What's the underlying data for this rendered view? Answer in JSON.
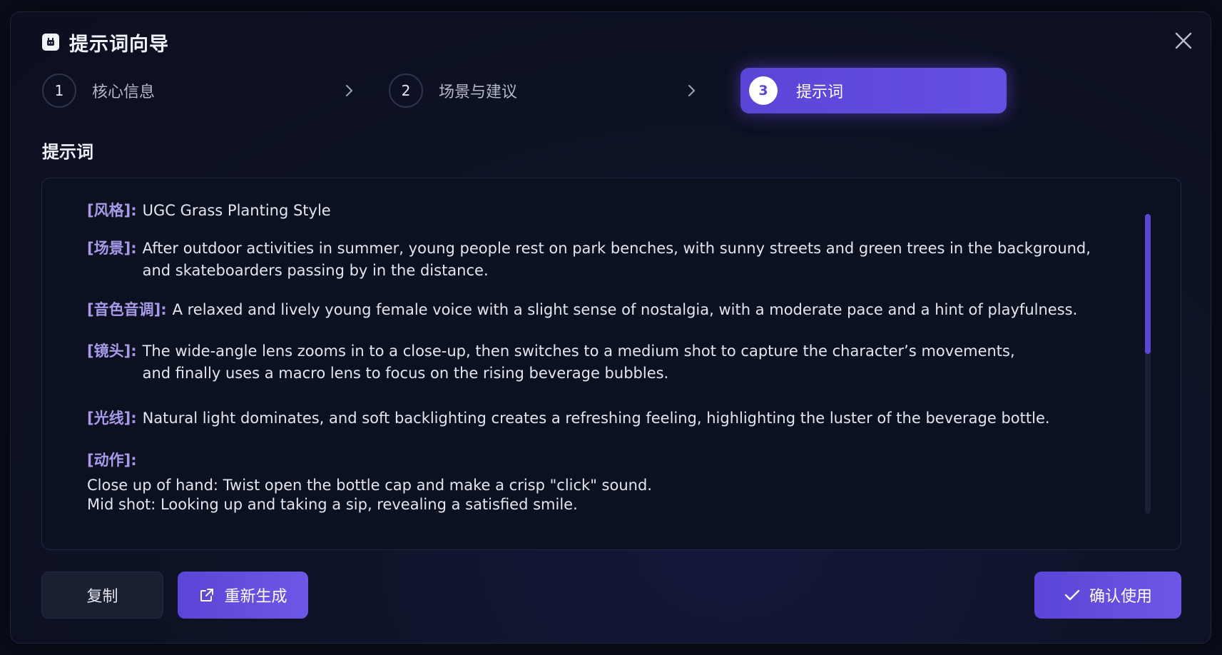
{
  "dialog": {
    "title": "提示词向导"
  },
  "steps": [
    {
      "number": "1",
      "label": "核心信息"
    },
    {
      "number": "2",
      "label": "场景与建议"
    },
    {
      "number": "3",
      "label": "提示词"
    }
  ],
  "section": {
    "title": "提示词"
  },
  "prompt": {
    "style_tag": "[风格]:",
    "style_text": "UGC Grass Planting Style",
    "scene_tag": "[场景]:",
    "scene_line1": "After outdoor activities in summer, young people rest on park benches, with sunny streets and green trees in the background,",
    "scene_line2": "and skateboarders passing by in the distance.",
    "voice_tag": "[音色音调]:",
    "voice_text": "A relaxed and lively young female voice with a slight sense of nostalgia, with a moderate pace and a hint of playfulness.",
    "lens_tag": "[镜头]:",
    "lens_line1": "The wide-angle lens zooms in to a close-up, then switches to a medium shot to capture the character’s movements,",
    "lens_line2": "and finally uses a macro lens to focus on the rising beverage bubbles.",
    "light_tag": "[光线]:",
    "light_text": "Natural light dominates, and soft backlighting creates a refreshing feeling, highlighting the luster of the beverage bottle.",
    "action_tag": "[动作]:",
    "action_line1": "Close up of hand: Twist open the bottle cap and make a crisp \"click\" sound.",
    "action_line2": "Mid shot: Looking up and taking a sip, revealing a satisfied smile."
  },
  "buttons": {
    "copy": "复制",
    "regenerate": "重新生成",
    "confirm": "确认使用"
  },
  "colors": {
    "accent": "#5a45d6",
    "tag": "#a89ae8",
    "background": "#0b0f1f"
  },
  "icons": {
    "app": "app-icon",
    "close": "close-icon",
    "step_chevron": "chevron-right-icon",
    "regenerate": "external-link-icon",
    "confirm": "check-icon"
  }
}
